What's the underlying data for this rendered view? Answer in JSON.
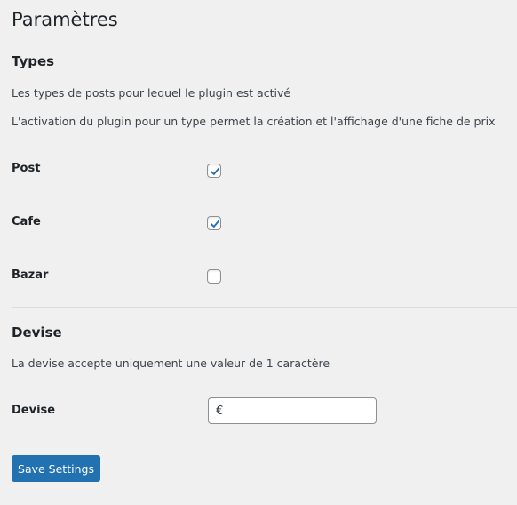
{
  "page": {
    "title": "Paramètres"
  },
  "types_section": {
    "title": "Types",
    "description_1": "Les types de posts pour lequel le plugin est activé",
    "description_2": "L'activation du plugin pour un type permet la création et l'affichage d'une fiche de prix",
    "fields": [
      {
        "label": "Post",
        "checked": true
      },
      {
        "label": "Cafe",
        "checked": true
      },
      {
        "label": "Bazar",
        "checked": false
      }
    ]
  },
  "devise_section": {
    "title": "Devise",
    "description": "La devise accepte uniquement une valeur de 1 caractère",
    "field_label": "Devise",
    "field_value": "€"
  },
  "actions": {
    "save_label": "Save Settings"
  },
  "colors": {
    "background": "#f0f0f1",
    "primary": "#2271b1",
    "text": "#1d2327"
  },
  "icons": {
    "checkmark": "checkmark-icon"
  }
}
